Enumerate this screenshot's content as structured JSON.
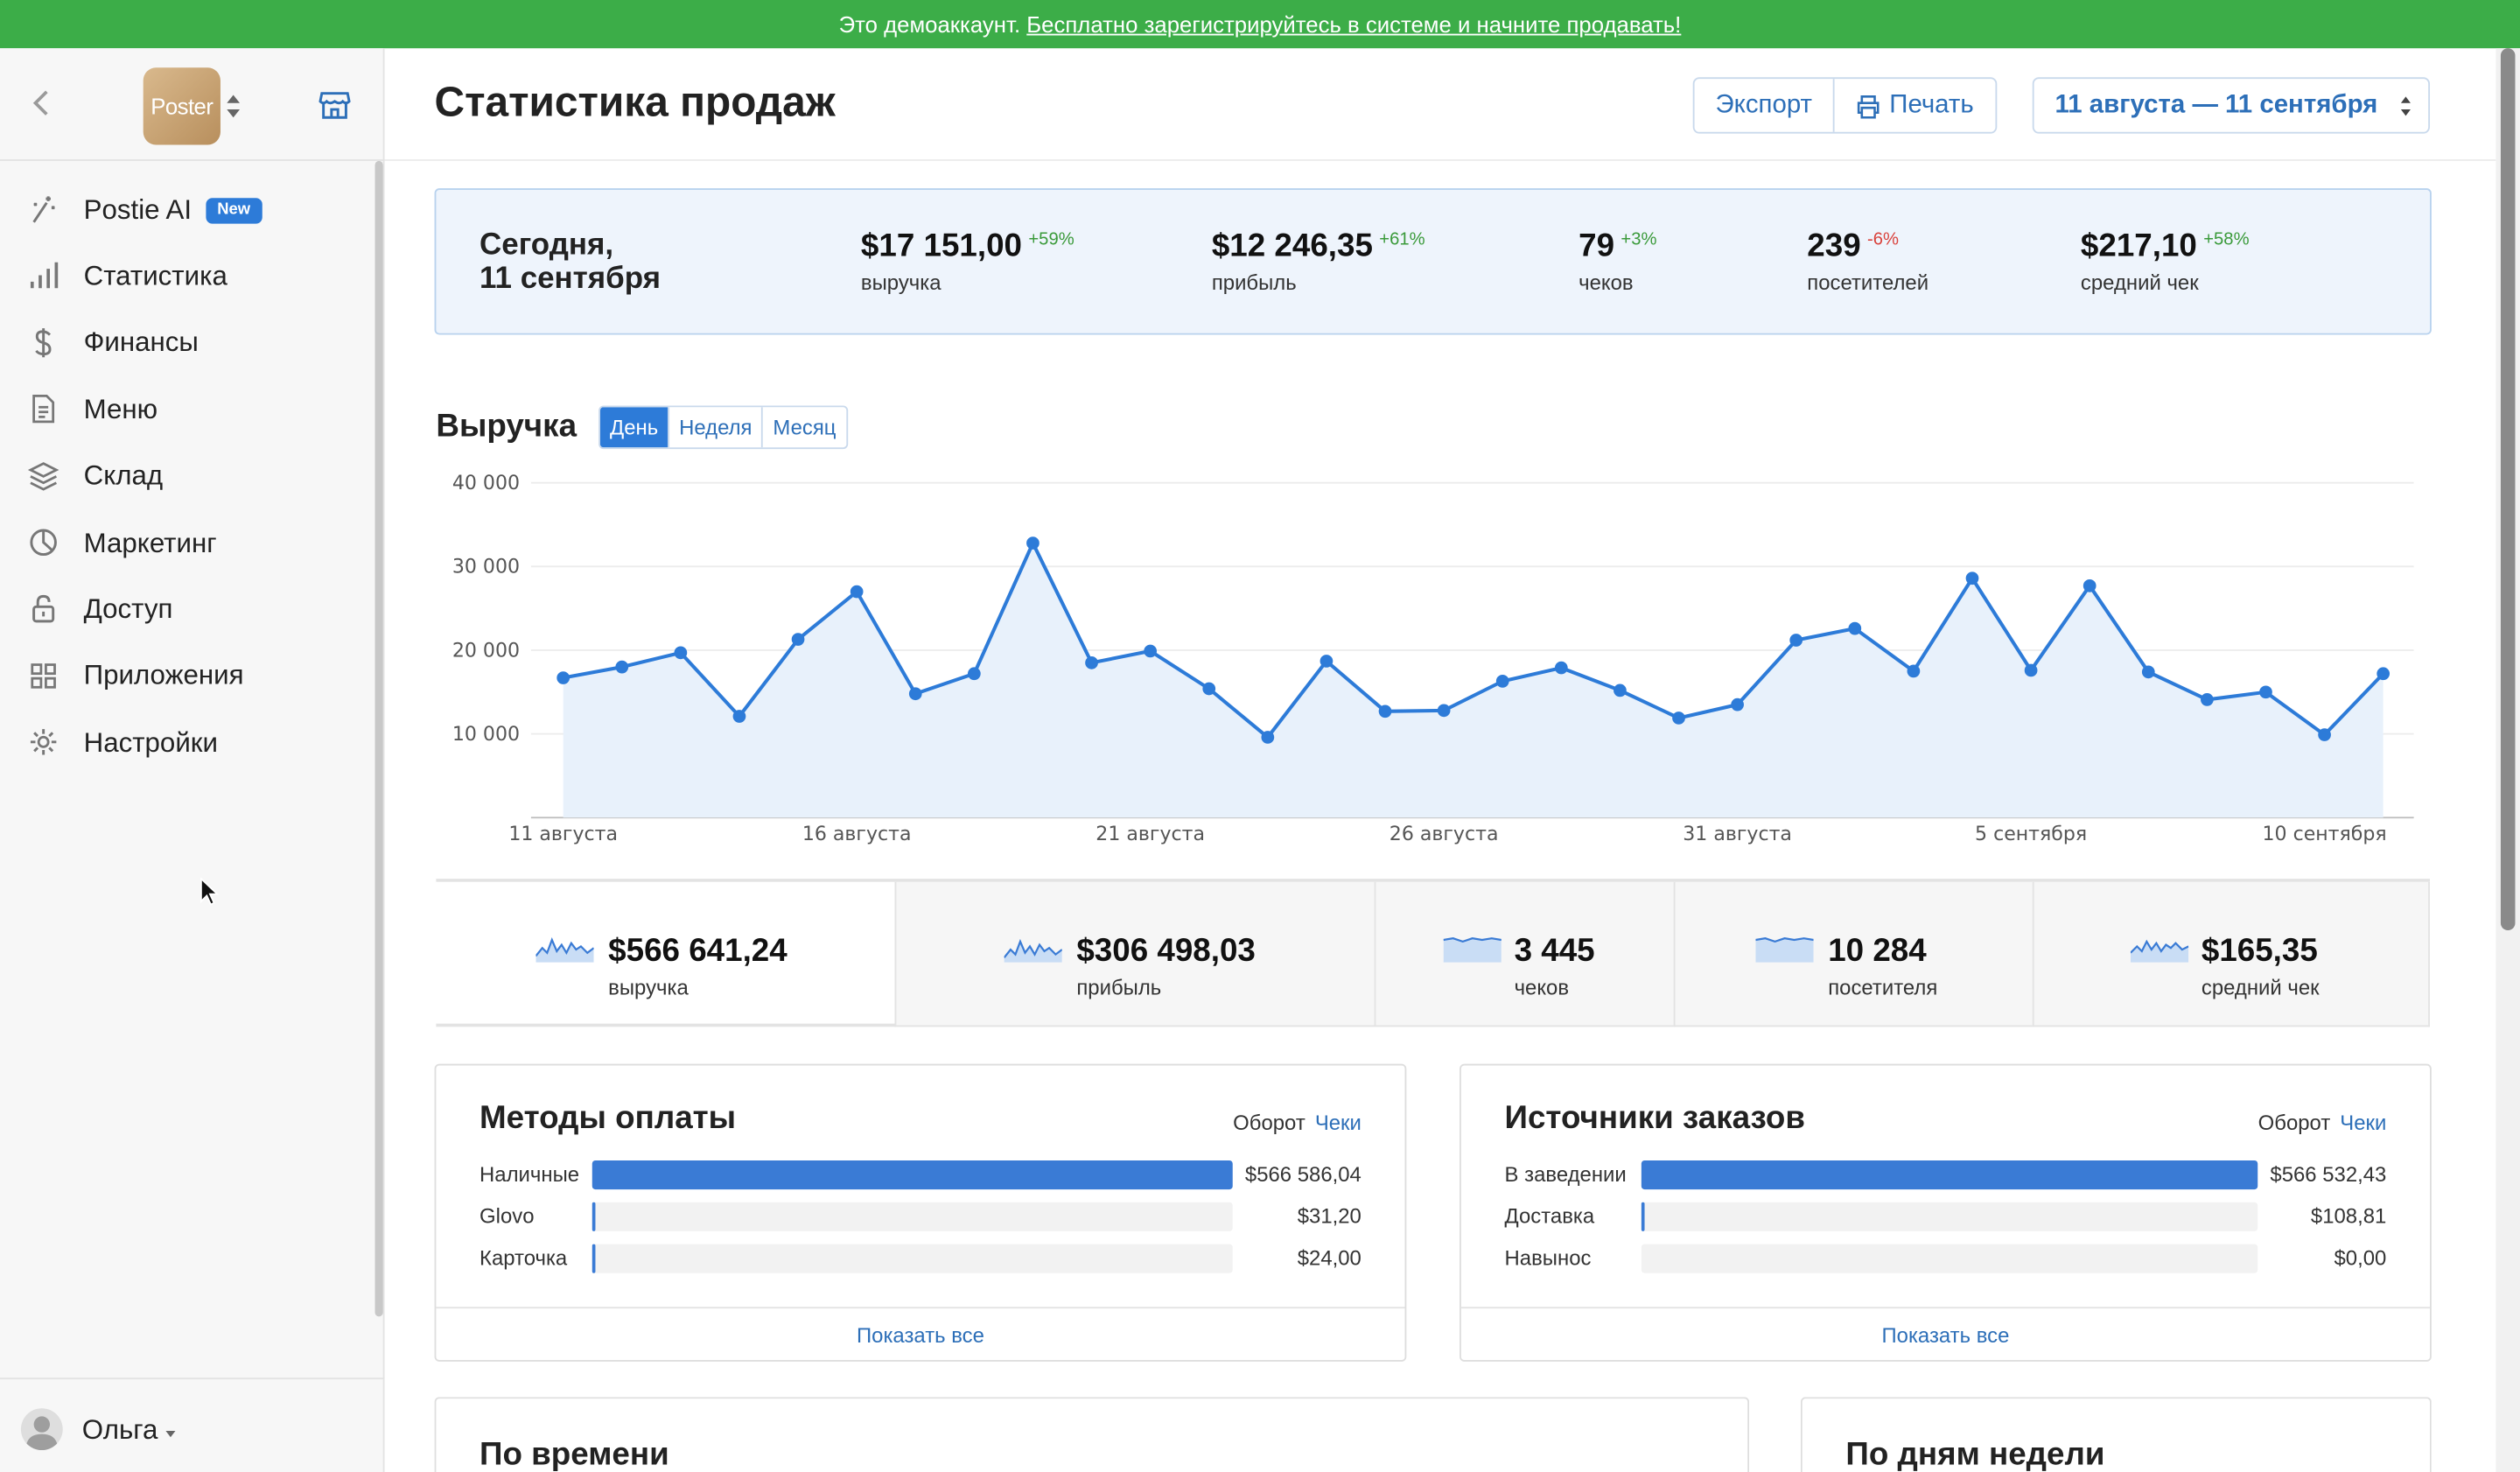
{
  "banner": {
    "text": "Это демоаккаунт.",
    "link": "Бесплатно зарегистрируйтесь в системе и начните продавать!",
    "color": "#3cad48"
  },
  "sidebar": {
    "logo_text": "Poster",
    "items": [
      {
        "label": "Postie AI",
        "icon": "ai-wand-icon",
        "badge": "New"
      },
      {
        "label": "Статистика",
        "icon": "bar-chart-icon"
      },
      {
        "label": "Финансы",
        "icon": "dollar-icon"
      },
      {
        "label": "Меню",
        "icon": "document-icon"
      },
      {
        "label": "Склад",
        "icon": "layers-icon"
      },
      {
        "label": "Маркетинг",
        "icon": "pie-icon"
      },
      {
        "label": "Доступ",
        "icon": "lock-icon"
      },
      {
        "label": "Приложения",
        "icon": "grid-icon"
      },
      {
        "label": "Настройки",
        "icon": "gear-icon"
      }
    ],
    "user": "Ольга"
  },
  "header": {
    "title": "Статистика продаж",
    "export_label": "Экспорт",
    "print_label": "Печать",
    "date_range": "11 августа — 11 сентября"
  },
  "today": {
    "label_line1": "Сегодня,",
    "label_line2": "11 сентября",
    "kpis": [
      {
        "value": "$17 151,00",
        "delta": "+59%",
        "caption": "выручка"
      },
      {
        "value": "$12 246,35",
        "delta": "+61%",
        "caption": "прибыль"
      },
      {
        "value": "79",
        "delta": "+3%",
        "caption": "чеков"
      },
      {
        "value": "239",
        "delta": "-6%",
        "caption": "посетителей"
      },
      {
        "value": "$217,10",
        "delta": "+58%",
        "caption": "средний чек"
      }
    ]
  },
  "revenue": {
    "title": "Выручка",
    "periods": [
      "День",
      "Неделя",
      "Месяц"
    ],
    "active_period": "День"
  },
  "chart_data": {
    "type": "area",
    "title": "Выручка",
    "ylim": [
      0,
      40000
    ],
    "yticks": [
      "10 000",
      "20 000",
      "30 000",
      "40 000"
    ],
    "xticks": [
      "11 августа",
      "16 августа",
      "21 августа",
      "26 августа",
      "31 августа",
      "5 сентября",
      "10 сентября"
    ],
    "x": [
      "11 авг",
      "12 авг",
      "13 авг",
      "14 авг",
      "15 авг",
      "16 авг",
      "17 авг",
      "18 авг",
      "19 авг",
      "20 авг",
      "21 авг",
      "22 авг",
      "23 авг",
      "24 авг",
      "25 авг",
      "26 авг",
      "27 авг",
      "28 авг",
      "29 авг",
      "30 авг",
      "31 авг",
      "1 сен",
      "2 сен",
      "3 сен",
      "4 сен",
      "5 сен",
      "6 сен",
      "7 сен",
      "8 сен",
      "9 сен",
      "10 сен",
      "11 сен"
    ],
    "series": [
      {
        "values": [
          16700,
          18000,
          19700,
          12100,
          21300,
          27000,
          14800,
          17200,
          32800,
          18500,
          19900,
          15400,
          9600,
          18700,
          12700,
          12800,
          16300,
          17900,
          15200,
          11900,
          13500,
          21200,
          22600,
          17500,
          28600,
          17600,
          27700,
          17400,
          14100,
          15000,
          9900,
          17200
        ]
      }
    ],
    "grid": true,
    "color": "#2d7bd8"
  },
  "totals": [
    {
      "value": "$566 641,24",
      "caption": "выручка"
    },
    {
      "value": "$306 498,03",
      "caption": "прибыль"
    },
    {
      "value": "3 445",
      "caption": "чеков"
    },
    {
      "value": "10 284",
      "caption": "посетителя"
    },
    {
      "value": "$165,35",
      "caption": "средний чек"
    }
  ],
  "payments": {
    "title": "Методы оплаты",
    "tab1": "Оборот",
    "tab2": "Чеки",
    "show_all": "Показать все",
    "rows": [
      {
        "label": "Наличные",
        "value": "$566 586,04",
        "share": 0.9999
      },
      {
        "label": "Glovo",
        "value": "$31,20",
        "share": 0.0001
      },
      {
        "label": "Карточка",
        "value": "$24,00",
        "share": 0.0001
      }
    ]
  },
  "sources": {
    "title": "Источники заказов",
    "tab1": "Оборот",
    "tab2": "Чеки",
    "show_all": "Показать все",
    "rows": [
      {
        "label": "В заведении",
        "value": "$566 532,43",
        "share": 0.9998
      },
      {
        "label": "Доставка",
        "value": "$108,81",
        "share": 0.0002
      },
      {
        "label": "Навынос",
        "value": "$0,00",
        "share": 0
      }
    ]
  },
  "by_time": {
    "title": "По времени"
  },
  "by_weekday": {
    "title": "По дням недели"
  }
}
